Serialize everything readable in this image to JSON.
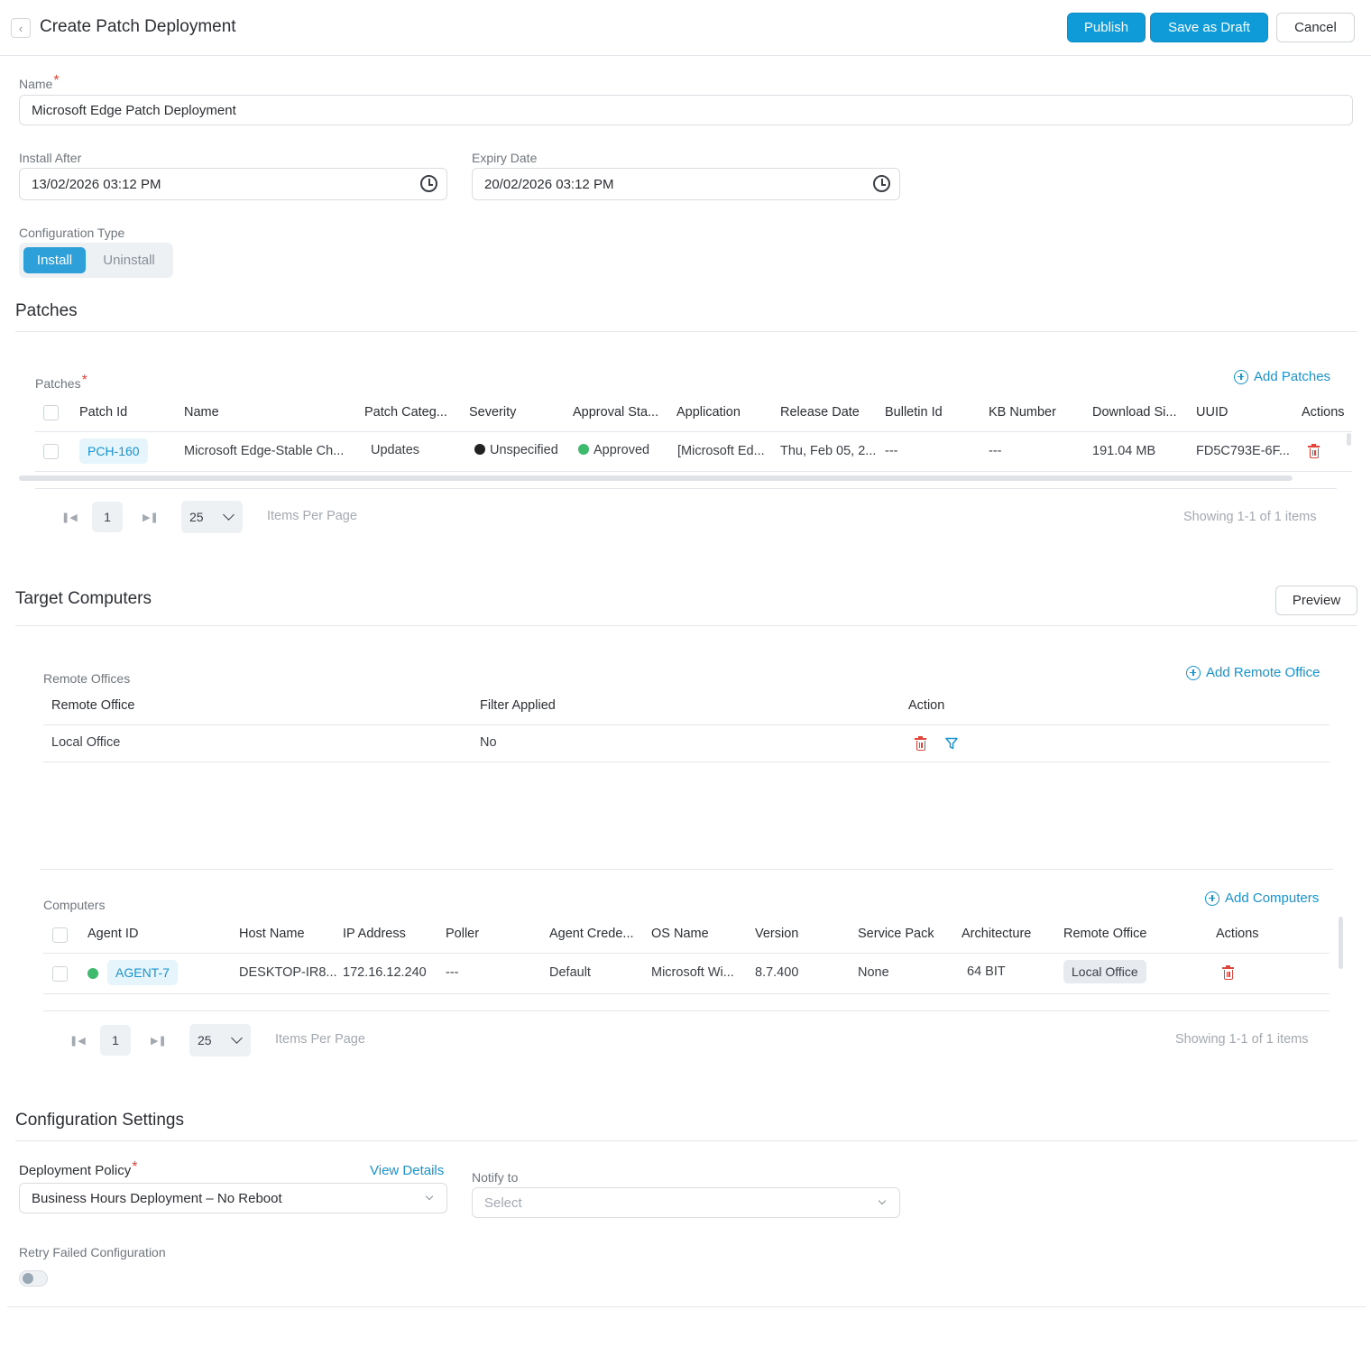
{
  "header": {
    "title": "Create Patch Deployment",
    "publish_label": "Publish",
    "save_draft_label": "Save as Draft",
    "cancel_label": "Cancel"
  },
  "form": {
    "name_label": "Name",
    "name_value": "Microsoft Edge Patch Deployment",
    "install_after_label": "Install After",
    "install_after_value": "13/02/2026 03:12 PM",
    "expiry_date_label": "Expiry Date",
    "expiry_date_value": "20/02/2026 03:12 PM",
    "config_type_label": "Configuration Type",
    "config_type_options": [
      "Install",
      "Uninstall"
    ],
    "config_type_selected": "Install"
  },
  "patches": {
    "section_title": "Patches",
    "table_label": "Patches",
    "add_label": "Add Patches",
    "columns": [
      "Patch Id",
      "Name",
      "Patch Categ...",
      "Severity",
      "Approval Sta...",
      "Application",
      "Release Date",
      "Bulletin Id",
      "KB Number",
      "Download Si...",
      "UUID",
      "Actions"
    ],
    "rows": [
      {
        "patch_id": "PCH-160",
        "name": "Microsoft Edge-Stable Ch...",
        "category": "Updates",
        "severity": "Unspecified",
        "approval": "Approved",
        "application": "[Microsoft Ed...",
        "release_date": "Thu, Feb 05, 2...",
        "bulletin_id": "---",
        "kb_number": "---",
        "download_size": "191.04 MB",
        "uuid": "FD5C793E-6F..."
      }
    ],
    "pager": {
      "page": "1",
      "per_page": "25",
      "per_page_label": "Items Per Page",
      "showing": "Showing 1-1 of 1 items"
    }
  },
  "targets": {
    "section_title": "Target Computers",
    "preview_label": "Preview",
    "remote_offices_label": "Remote Offices",
    "add_remote_office_label": "Add Remote Office",
    "ro_columns": [
      "Remote Office",
      "Filter Applied",
      "Action"
    ],
    "ro_rows": [
      {
        "office": "Local Office",
        "filter": "No"
      }
    ],
    "computers_label": "Computers",
    "add_computers_label": "Add Computers",
    "pc_columns": [
      "Agent ID",
      "Host Name",
      "IP Address",
      "Poller",
      "Agent Crede...",
      "OS Name",
      "Version",
      "Service Pack",
      "Architecture",
      "Remote Office",
      "Actions"
    ],
    "pc_rows": [
      {
        "agent_id": "AGENT-7",
        "host": "DESKTOP-IR8...",
        "ip": "172.16.12.240",
        "poller": "---",
        "credential": "Default",
        "os": "Microsoft Wi...",
        "version": "8.7.400",
        "service_pack": "None",
        "arch": "64 BIT",
        "remote_office": "Local Office"
      }
    ],
    "pager": {
      "page": "1",
      "per_page": "25",
      "per_page_label": "Items Per Page",
      "showing": "Showing 1-1 of 1 items"
    }
  },
  "config": {
    "section_title": "Configuration Settings",
    "policy_label": "Deployment Policy",
    "view_details_label": "View Details",
    "policy_value": "Business Hours Deployment – No Reboot",
    "notify_label": "Notify to",
    "notify_placeholder": "Select",
    "retry_label": "Retry Failed Configuration",
    "retry_enabled": false
  },
  "colors": {
    "accent": "#0e9bd8",
    "danger": "#e0443a",
    "status_green": "#3dba6b",
    "severity_dark": "#222222"
  }
}
